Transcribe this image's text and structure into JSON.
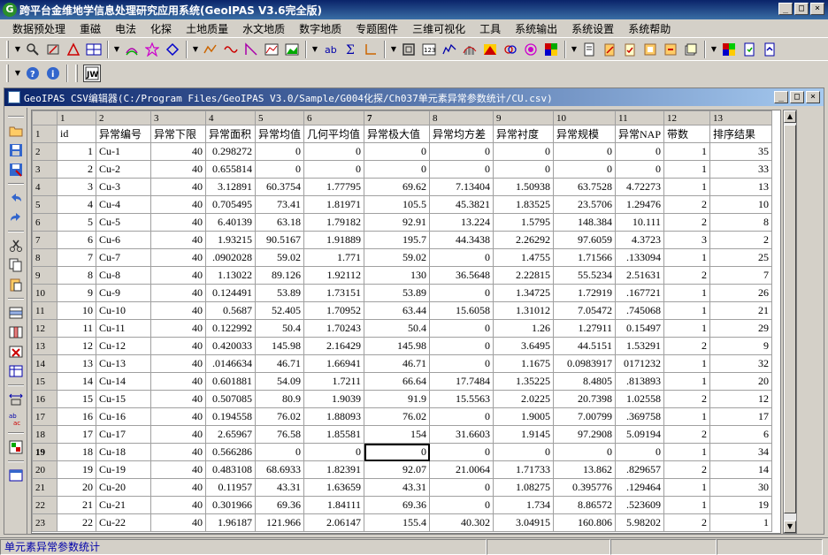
{
  "window": {
    "title": "跨平台金维地学信息处理研究应用系统(GeoIPAS V3.6完全版)",
    "minimize": "_",
    "maximize": "□",
    "close": "×"
  },
  "menu": [
    "数据预处理",
    "重磁",
    "电法",
    "化探",
    "土地质量",
    "水文地质",
    "数字地质",
    "专题图件",
    "三维可视化",
    "工具",
    "系统输出",
    "系统设置",
    "系统帮助"
  ],
  "child": {
    "title": "GeoIPAS CSV编辑器(C:/Program Files/GeoIPAS V3.0/Sample/G004化探/Ch037单元素异常参数统计/CU.csv)"
  },
  "grid": {
    "col_numbers": [
      "1",
      "2",
      "3",
      "4",
      "5",
      "6",
      "7",
      "8",
      "9",
      "10",
      "11",
      "12",
      "13"
    ],
    "header_row": [
      "id",
      "异常编号",
      "异常下限",
      "异常面积",
      "异常均值",
      "几何平均值",
      "异常极大值",
      "异常均方差",
      "异常衬度",
      "异常规模",
      "异常NAP",
      "带数",
      "排序结果"
    ],
    "rows": [
      [
        "1",
        "Cu-1",
        "40",
        "0.298272",
        "0",
        "0",
        "0",
        "0",
        "0",
        "0",
        "0",
        "1",
        "35"
      ],
      [
        "2",
        "Cu-2",
        "40",
        "0.655814",
        "0",
        "0",
        "0",
        "0",
        "0",
        "0",
        "0",
        "1",
        "33"
      ],
      [
        "3",
        "Cu-3",
        "40",
        "3.12891",
        "60.3754",
        "1.77795",
        "69.62",
        "7.13404",
        "1.50938",
        "63.7528",
        "4.72273",
        "1",
        "13"
      ],
      [
        "4",
        "Cu-4",
        "40",
        "0.705495",
        "73.41",
        "1.81971",
        "105.5",
        "45.3821",
        "1.83525",
        "23.5706",
        "1.29476",
        "2",
        "10"
      ],
      [
        "5",
        "Cu-5",
        "40",
        "6.40139",
        "63.18",
        "1.79182",
        "92.91",
        "13.224",
        "1.5795",
        "148.384",
        "10.111",
        "2",
        "8"
      ],
      [
        "6",
        "Cu-6",
        "40",
        "1.93215",
        "90.5167",
        "1.91889",
        "195.7",
        "44.3438",
        "2.26292",
        "97.6059",
        "4.3723",
        "3",
        "2"
      ],
      [
        "7",
        "Cu-7",
        "40",
        ".0902028",
        "59.02",
        "1.771",
        "59.02",
        "0",
        "1.4755",
        "1.71566",
        ".133094",
        "1",
        "25"
      ],
      [
        "8",
        "Cu-8",
        "40",
        "1.13022",
        "89.126",
        "1.92112",
        "130",
        "36.5648",
        "2.22815",
        "55.5234",
        "2.51631",
        "2",
        "7"
      ],
      [
        "9",
        "Cu-9",
        "40",
        "0.124491",
        "53.89",
        "1.73151",
        "53.89",
        "0",
        "1.34725",
        "1.72919",
        ".167721",
        "1",
        "26"
      ],
      [
        "10",
        "Cu-10",
        "40",
        "0.5687",
        "52.405",
        "1.70952",
        "63.44",
        "15.6058",
        "1.31012",
        "7.05472",
        ".745068",
        "1",
        "21"
      ],
      [
        "11",
        "Cu-11",
        "40",
        "0.122992",
        "50.4",
        "1.70243",
        "50.4",
        "0",
        "1.26",
        "1.27911",
        "0.15497",
        "1",
        "29"
      ],
      [
        "12",
        "Cu-12",
        "40",
        "0.420033",
        "145.98",
        "2.16429",
        "145.98",
        "0",
        "3.6495",
        "44.5151",
        "1.53291",
        "2",
        "9"
      ],
      [
        "13",
        "Cu-13",
        "40",
        ".0146634",
        "46.71",
        "1.66941",
        "46.71",
        "0",
        "1.1675",
        "0.0983917",
        "0171232",
        "1",
        "32"
      ],
      [
        "14",
        "Cu-14",
        "40",
        "0.601881",
        "54.09",
        "1.7211",
        "66.64",
        "17.7484",
        "1.35225",
        "8.4805",
        ".813893",
        "1",
        "20"
      ],
      [
        "15",
        "Cu-15",
        "40",
        "0.507085",
        "80.9",
        "1.9039",
        "91.9",
        "15.5563",
        "2.0225",
        "20.7398",
        "1.02558",
        "2",
        "12"
      ],
      [
        "16",
        "Cu-16",
        "40",
        "0.194558",
        "76.02",
        "1.88093",
        "76.02",
        "0",
        "1.9005",
        "7.00799",
        ".369758",
        "1",
        "17"
      ],
      [
        "17",
        "Cu-17",
        "40",
        "2.65967",
        "76.58",
        "1.85581",
        "154",
        "31.6603",
        "1.9145",
        "97.2908",
        "5.09194",
        "2",
        "6"
      ],
      [
        "18",
        "Cu-18",
        "40",
        "0.566286",
        "0",
        "0",
        "0",
        "0",
        "0",
        "0",
        "0",
        "1",
        "34"
      ],
      [
        "19",
        "Cu-19",
        "40",
        "0.483108",
        "68.6933",
        "1.82391",
        "92.07",
        "21.0064",
        "1.71733",
        "13.862",
        ".829657",
        "2",
        "14"
      ],
      [
        "20",
        "Cu-20",
        "40",
        "0.11957",
        "43.31",
        "1.63659",
        "43.31",
        "0",
        "1.08275",
        "0.395776",
        ".129464",
        "1",
        "30"
      ],
      [
        "21",
        "Cu-21",
        "40",
        "0.301966",
        "69.36",
        "1.84111",
        "69.36",
        "0",
        "1.734",
        "8.86572",
        ".523609",
        "1",
        "19"
      ],
      [
        "22",
        "Cu-22",
        "40",
        "1.96187",
        "121.966",
        "2.06147",
        "155.4",
        "40.302",
        "3.04915",
        "160.806",
        "5.98202",
        "2",
        "1"
      ]
    ]
  },
  "statusbar": {
    "text": "单元素异常参数统计"
  },
  "icons": {
    "help": "?",
    "info": "i"
  }
}
